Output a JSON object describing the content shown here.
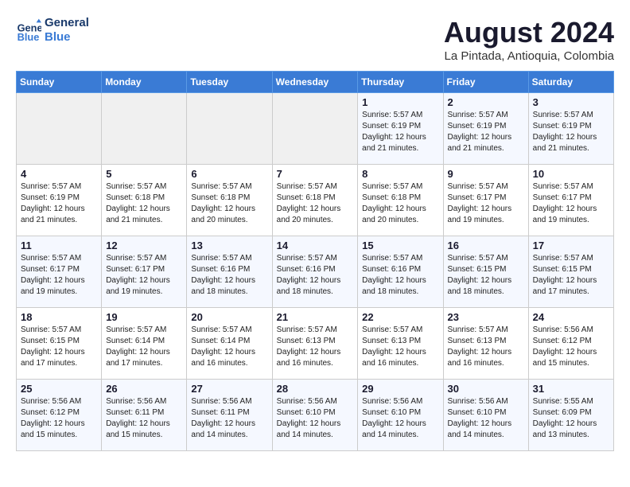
{
  "header": {
    "logo_line1": "General",
    "logo_line2": "Blue",
    "month": "August 2024",
    "location": "La Pintada, Antioquia, Colombia"
  },
  "weekdays": [
    "Sunday",
    "Monday",
    "Tuesday",
    "Wednesday",
    "Thursday",
    "Friday",
    "Saturday"
  ],
  "weeks": [
    [
      {
        "day": "",
        "info": ""
      },
      {
        "day": "",
        "info": ""
      },
      {
        "day": "",
        "info": ""
      },
      {
        "day": "",
        "info": ""
      },
      {
        "day": "1",
        "info": "Sunrise: 5:57 AM\nSunset: 6:19 PM\nDaylight: 12 hours\nand 21 minutes."
      },
      {
        "day": "2",
        "info": "Sunrise: 5:57 AM\nSunset: 6:19 PM\nDaylight: 12 hours\nand 21 minutes."
      },
      {
        "day": "3",
        "info": "Sunrise: 5:57 AM\nSunset: 6:19 PM\nDaylight: 12 hours\nand 21 minutes."
      }
    ],
    [
      {
        "day": "4",
        "info": "Sunrise: 5:57 AM\nSunset: 6:19 PM\nDaylight: 12 hours\nand 21 minutes."
      },
      {
        "day": "5",
        "info": "Sunrise: 5:57 AM\nSunset: 6:18 PM\nDaylight: 12 hours\nand 21 minutes."
      },
      {
        "day": "6",
        "info": "Sunrise: 5:57 AM\nSunset: 6:18 PM\nDaylight: 12 hours\nand 20 minutes."
      },
      {
        "day": "7",
        "info": "Sunrise: 5:57 AM\nSunset: 6:18 PM\nDaylight: 12 hours\nand 20 minutes."
      },
      {
        "day": "8",
        "info": "Sunrise: 5:57 AM\nSunset: 6:18 PM\nDaylight: 12 hours\nand 20 minutes."
      },
      {
        "day": "9",
        "info": "Sunrise: 5:57 AM\nSunset: 6:17 PM\nDaylight: 12 hours\nand 19 minutes."
      },
      {
        "day": "10",
        "info": "Sunrise: 5:57 AM\nSunset: 6:17 PM\nDaylight: 12 hours\nand 19 minutes."
      }
    ],
    [
      {
        "day": "11",
        "info": "Sunrise: 5:57 AM\nSunset: 6:17 PM\nDaylight: 12 hours\nand 19 minutes."
      },
      {
        "day": "12",
        "info": "Sunrise: 5:57 AM\nSunset: 6:17 PM\nDaylight: 12 hours\nand 19 minutes."
      },
      {
        "day": "13",
        "info": "Sunrise: 5:57 AM\nSunset: 6:16 PM\nDaylight: 12 hours\nand 18 minutes."
      },
      {
        "day": "14",
        "info": "Sunrise: 5:57 AM\nSunset: 6:16 PM\nDaylight: 12 hours\nand 18 minutes."
      },
      {
        "day": "15",
        "info": "Sunrise: 5:57 AM\nSunset: 6:16 PM\nDaylight: 12 hours\nand 18 minutes."
      },
      {
        "day": "16",
        "info": "Sunrise: 5:57 AM\nSunset: 6:15 PM\nDaylight: 12 hours\nand 18 minutes."
      },
      {
        "day": "17",
        "info": "Sunrise: 5:57 AM\nSunset: 6:15 PM\nDaylight: 12 hours\nand 17 minutes."
      }
    ],
    [
      {
        "day": "18",
        "info": "Sunrise: 5:57 AM\nSunset: 6:15 PM\nDaylight: 12 hours\nand 17 minutes."
      },
      {
        "day": "19",
        "info": "Sunrise: 5:57 AM\nSunset: 6:14 PM\nDaylight: 12 hours\nand 17 minutes."
      },
      {
        "day": "20",
        "info": "Sunrise: 5:57 AM\nSunset: 6:14 PM\nDaylight: 12 hours\nand 16 minutes."
      },
      {
        "day": "21",
        "info": "Sunrise: 5:57 AM\nSunset: 6:13 PM\nDaylight: 12 hours\nand 16 minutes."
      },
      {
        "day": "22",
        "info": "Sunrise: 5:57 AM\nSunset: 6:13 PM\nDaylight: 12 hours\nand 16 minutes."
      },
      {
        "day": "23",
        "info": "Sunrise: 5:57 AM\nSunset: 6:13 PM\nDaylight: 12 hours\nand 16 minutes."
      },
      {
        "day": "24",
        "info": "Sunrise: 5:56 AM\nSunset: 6:12 PM\nDaylight: 12 hours\nand 15 minutes."
      }
    ],
    [
      {
        "day": "25",
        "info": "Sunrise: 5:56 AM\nSunset: 6:12 PM\nDaylight: 12 hours\nand 15 minutes."
      },
      {
        "day": "26",
        "info": "Sunrise: 5:56 AM\nSunset: 6:11 PM\nDaylight: 12 hours\nand 15 minutes."
      },
      {
        "day": "27",
        "info": "Sunrise: 5:56 AM\nSunset: 6:11 PM\nDaylight: 12 hours\nand 14 minutes."
      },
      {
        "day": "28",
        "info": "Sunrise: 5:56 AM\nSunset: 6:10 PM\nDaylight: 12 hours\nand 14 minutes."
      },
      {
        "day": "29",
        "info": "Sunrise: 5:56 AM\nSunset: 6:10 PM\nDaylight: 12 hours\nand 14 minutes."
      },
      {
        "day": "30",
        "info": "Sunrise: 5:56 AM\nSunset: 6:10 PM\nDaylight: 12 hours\nand 14 minutes."
      },
      {
        "day": "31",
        "info": "Sunrise: 5:55 AM\nSunset: 6:09 PM\nDaylight: 12 hours\nand 13 minutes."
      }
    ]
  ]
}
